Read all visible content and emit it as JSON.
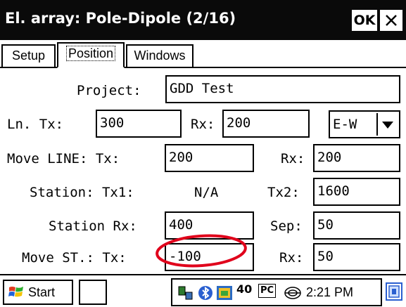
{
  "window": {
    "title": "El. array: Pole-Dipole (2/16)",
    "ok_label": "OK"
  },
  "tabs": [
    {
      "label": "Setup",
      "active": false
    },
    {
      "label": "Position",
      "active": true
    },
    {
      "label": "Windows",
      "active": false
    }
  ],
  "form": {
    "project": {
      "label": "Project:",
      "value": "GDD Test"
    },
    "line": {
      "label": "Ln. Tx:",
      "tx_value": "300",
      "rx_label": "Rx:",
      "rx_value": "200",
      "direction": "E-W"
    },
    "move_line": {
      "label": "Move LINE: Tx:",
      "tx_value": "200",
      "rx_label": "Rx:",
      "rx_value": "200"
    },
    "station": {
      "label": "Station: Tx1:",
      "tx1_value": "N/A",
      "tx2_label": "Tx2:",
      "tx2_value": "1600"
    },
    "station_rx": {
      "label": "Station Rx:",
      "value": "400",
      "sep_label": "Sep:",
      "sep_value": "50"
    },
    "move_st": {
      "label": "Move ST.: Tx:",
      "tx_value": "-100",
      "rx_label": "Rx:",
      "rx_value": "50"
    }
  },
  "taskbar": {
    "start_label": "Start",
    "time": "2:21 PM",
    "tray_pc_label": "PC",
    "tray_signal_label": "40"
  },
  "colors": {
    "titlebar_bg": "#0a0a0a",
    "annotation_circle": "#e0001b"
  }
}
